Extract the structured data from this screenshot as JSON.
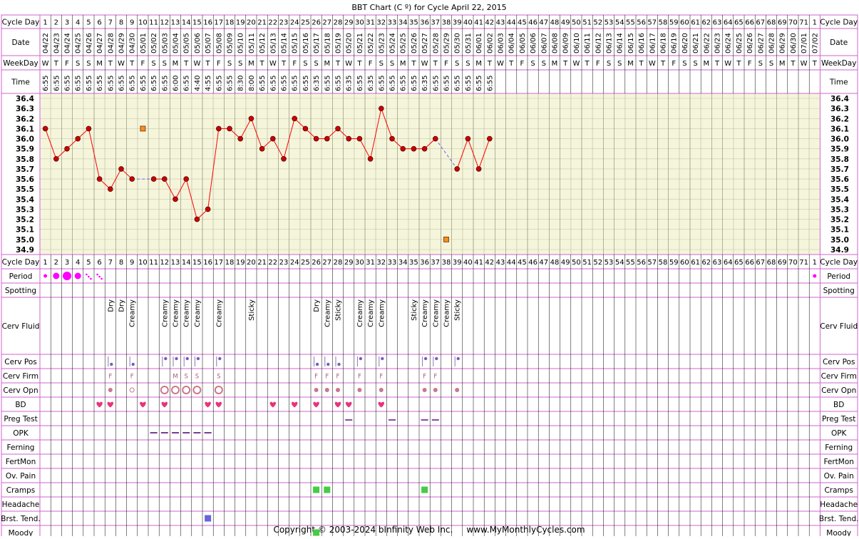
{
  "title": "BBT Chart (C º) for Cycle April 22, 2015",
  "copyright": "Copyright © 2003-2024 bInfinity Web Inc.     www.MyMonthlyCycles.com",
  "header_labels": {
    "cycle_day": "Cycle Day",
    "date": "Date",
    "weekday": "WeekDay",
    "time": "Time"
  },
  "row_labels": [
    "Period",
    "Spotting",
    "Cerv Fluid",
    "Cerv Pos",
    "Cerv Firm",
    "Cerv Opn",
    "BD",
    "Preg Test",
    "OPK",
    "Ferning",
    "FertMon",
    "Ov. Pain",
    "Cramps",
    "Headache",
    "Brst. Tend.",
    "Moody"
  ],
  "colors": {
    "border": "#cc66cc",
    "temp_bg": "#f5f5dc",
    "line": "#ff0000",
    "dot": "#cc0000",
    "heart": "#e8337a",
    "period": "#ff00ff",
    "cramps": "#44cc44",
    "breast": "#6666dd",
    "opk": "#7a3a9a",
    "orange_marker": "#ff8c1a"
  },
  "days": [
    1,
    2,
    3,
    4,
    5,
    6,
    7,
    8,
    9,
    10,
    11,
    12,
    13,
    14,
    15,
    16,
    17,
    18,
    19,
    20,
    21,
    22,
    23,
    24,
    25,
    26,
    27,
    28,
    29,
    30,
    31,
    32,
    33,
    34,
    35,
    36,
    37,
    38,
    39,
    40,
    41,
    42,
    43,
    44,
    45,
    46,
    47,
    48,
    49,
    50,
    51,
    52,
    53,
    54,
    55,
    56,
    57,
    58,
    59,
    60,
    61,
    62,
    63,
    64,
    65,
    66,
    67,
    68,
    69,
    70,
    71,
    1
  ],
  "dates": [
    "04/22",
    "04/23",
    "04/24",
    "04/25",
    "04/26",
    "04/27",
    "04/28",
    "04/29",
    "04/30",
    "05/01",
    "05/02",
    "05/03",
    "05/04",
    "05/05",
    "05/06",
    "05/07",
    "05/08",
    "05/09",
    "05/10",
    "05/11",
    "05/12",
    "05/13",
    "05/14",
    "05/15",
    "05/16",
    "05/17",
    "05/18",
    "05/19",
    "05/20",
    "05/21",
    "05/22",
    "05/23",
    "05/24",
    "05/25",
    "05/26",
    "05/27",
    "05/28",
    "05/29",
    "05/30",
    "05/31",
    "06/01",
    "06/02",
    "06/03",
    "06/04",
    "06/05",
    "06/06",
    "06/07",
    "06/08",
    "06/09",
    "06/10",
    "06/11",
    "06/12",
    "06/13",
    "06/14",
    "06/15",
    "06/16",
    "06/17",
    "06/18",
    "06/19",
    "06/20",
    "06/21",
    "06/22",
    "06/23",
    "06/24",
    "06/25",
    "06/26",
    "06/27",
    "06/28",
    "06/29",
    "06/30",
    "07/01",
    "07/02"
  ],
  "weekdays": [
    "W",
    "T",
    "F",
    "S",
    "S",
    "M",
    "T",
    "W",
    "T",
    "F",
    "S",
    "S",
    "M",
    "T",
    "W",
    "T",
    "F",
    "S",
    "S",
    "M",
    "T",
    "W",
    "T",
    "F",
    "S",
    "S",
    "M",
    "T",
    "W",
    "T",
    "F",
    "S",
    "S",
    "M",
    "T",
    "W",
    "T",
    "F",
    "S",
    "S",
    "M",
    "T",
    "W",
    "T",
    "F",
    "S",
    "S",
    "M",
    "T",
    "W",
    "T",
    "F",
    "S",
    "S",
    "M",
    "T",
    "W",
    "T",
    "F",
    "S",
    "S",
    "M",
    "T",
    "W",
    "T",
    "F",
    "S",
    "S",
    "M",
    "T",
    "W",
    "T"
  ],
  "times": [
    "6:55",
    "6:55",
    "6:55",
    "6:55",
    "6:55",
    "6:55",
    "6:55",
    "6:55",
    "6:55",
    "6:55",
    "6:55",
    "6:55",
    "6:00",
    "6:55",
    "4:40",
    "4:55",
    "6:55",
    "6:55",
    "8:30",
    "8:00",
    "6:55",
    "6:55",
    "6:55",
    "6:55",
    "6:55",
    "6:35",
    "6:55",
    "6:55",
    "6:35",
    "6:55",
    "6:35",
    "6:55",
    "6:55",
    "6:55",
    "6:55",
    "6:35",
    "6:55",
    "6:55",
    "6:55",
    "6:55",
    "6:55",
    "6:55"
  ],
  "chart_data": {
    "type": "line",
    "title": "BBT Chart (C º) for Cycle April 22, 2015",
    "x": [
      1,
      2,
      3,
      4,
      5,
      6,
      7,
      8,
      9,
      10,
      11,
      12,
      13,
      14,
      15,
      16,
      17,
      18,
      19,
      20,
      21,
      22,
      23,
      24,
      25,
      26,
      27,
      28,
      29,
      30,
      31,
      32,
      33,
      34,
      35,
      36,
      37,
      38,
      39,
      40,
      41,
      42
    ],
    "series": [
      {
        "values": [
          36.1,
          35.8,
          35.9,
          36.0,
          36.1,
          35.6,
          35.5,
          35.7,
          35.6,
          null,
          35.6,
          35.6,
          35.4,
          35.6,
          35.2,
          35.3,
          36.1,
          36.1,
          36.0,
          36.2,
          35.9,
          36.0,
          35.8,
          36.2,
          36.1,
          36.0,
          36.0,
          36.1,
          36.0,
          36.0,
          35.8,
          36.3,
          36.0,
          35.9,
          35.9,
          35.9,
          36.0,
          null,
          35.7,
          36.0,
          35.7,
          36.0
        ]
      }
    ],
    "dashed_gaps": [
      [
        9,
        11
      ],
      [
        37,
        39
      ]
    ],
    "excluded_points": [
      {
        "x": 10,
        "y": 36.1
      },
      {
        "x": 38,
        "y": 35.0
      }
    ],
    "y_ticks": [
      36.4,
      36.3,
      36.2,
      36.1,
      36.0,
      35.9,
      35.8,
      35.7,
      35.6,
      35.5,
      35.4,
      35.3,
      35.2,
      35.1,
      35.0,
      34.9
    ],
    "ylim": [
      34.9,
      36.4
    ],
    "grid": true
  },
  "period": [
    {
      "day": 1,
      "level": "spot"
    },
    {
      "day": 2,
      "level": "medium"
    },
    {
      "day": 3,
      "level": "heavy"
    },
    {
      "day": 4,
      "level": "medium"
    },
    {
      "day": 5,
      "level": "light"
    },
    {
      "day": 6,
      "level": "light"
    },
    {
      "day": 72,
      "level": "spot"
    }
  ],
  "cerv_fluid": [
    {
      "day": 7,
      "text": "Dry"
    },
    {
      "day": 8,
      "text": "Dry"
    },
    {
      "day": 9,
      "text": "Creamy"
    },
    {
      "day": 12,
      "text": "Creamy"
    },
    {
      "day": 13,
      "text": "Creamy"
    },
    {
      "day": 14,
      "text": "Creamy"
    },
    {
      "day": 15,
      "text": "Creamy"
    },
    {
      "day": 17,
      "text": "Creamy"
    },
    {
      "day": 20,
      "text": "Sticky"
    },
    {
      "day": 26,
      "text": "Dry"
    },
    {
      "day": 27,
      "text": "Creamy"
    },
    {
      "day": 28,
      "text": "Sticky"
    },
    {
      "day": 30,
      "text": "Creamy"
    },
    {
      "day": 31,
      "text": "Creamy"
    },
    {
      "day": 32,
      "text": "Creamy"
    },
    {
      "day": 35,
      "text": "Sticky"
    },
    {
      "day": 36,
      "text": "Creamy"
    },
    {
      "day": 37,
      "text": "Creamy"
    },
    {
      "day": 38,
      "text": "Creamy"
    },
    {
      "day": 39,
      "text": "Sticky"
    }
  ],
  "cerv_pos": [
    {
      "day": 7,
      "pos": "low"
    },
    {
      "day": 9,
      "pos": "low"
    },
    {
      "day": 12,
      "pos": "high"
    },
    {
      "day": 13,
      "pos": "high"
    },
    {
      "day": 14,
      "pos": "high"
    },
    {
      "day": 15,
      "pos": "high"
    },
    {
      "day": 17,
      "pos": "high"
    },
    {
      "day": 26,
      "pos": "low"
    },
    {
      "day": 27,
      "pos": "low"
    },
    {
      "day": 28,
      "pos": "low"
    },
    {
      "day": 30,
      "pos": "high"
    },
    {
      "day": 32,
      "pos": "high"
    },
    {
      "day": 36,
      "pos": "high"
    },
    {
      "day": 37,
      "pos": "high"
    },
    {
      "day": 39,
      "pos": "high"
    }
  ],
  "cerv_firm": [
    {
      "day": 7,
      "text": "F"
    },
    {
      "day": 9,
      "text": "F"
    },
    {
      "day": 13,
      "text": "M"
    },
    {
      "day": 14,
      "text": "S"
    },
    {
      "day": 15,
      "text": "S"
    },
    {
      "day": 17,
      "text": "S"
    },
    {
      "day": 26,
      "text": "F"
    },
    {
      "day": 27,
      "text": "F"
    },
    {
      "day": 28,
      "text": "F"
    },
    {
      "day": 30,
      "text": "F"
    },
    {
      "day": 32,
      "text": "F"
    },
    {
      "day": 36,
      "text": "F"
    },
    {
      "day": 37,
      "text": "F"
    }
  ],
  "cerv_opn": [
    {
      "day": 7,
      "size": "small"
    },
    {
      "day": 9,
      "size": "medium"
    },
    {
      "day": 12,
      "size": "large"
    },
    {
      "day": 13,
      "size": "large"
    },
    {
      "day": 14,
      "size": "large"
    },
    {
      "day": 15,
      "size": "large"
    },
    {
      "day": 17,
      "size": "large"
    },
    {
      "day": 26,
      "size": "small"
    },
    {
      "day": 27,
      "size": "small"
    },
    {
      "day": 28,
      "size": "small"
    },
    {
      "day": 30,
      "size": "small"
    },
    {
      "day": 32,
      "size": "small"
    },
    {
      "day": 36,
      "size": "small"
    },
    {
      "day": 37,
      "size": "small"
    },
    {
      "day": 39,
      "size": "small"
    }
  ],
  "bd": [
    6,
    7,
    10,
    12,
    16,
    17,
    22,
    24,
    26,
    28,
    29,
    32
  ],
  "preg_test": [
    29,
    33,
    36,
    37
  ],
  "opk": [
    11,
    12,
    13,
    14,
    15,
    16
  ],
  "cramps": [
    26,
    27,
    36
  ],
  "breast_tend": [
    16
  ],
  "moody": [
    26
  ]
}
